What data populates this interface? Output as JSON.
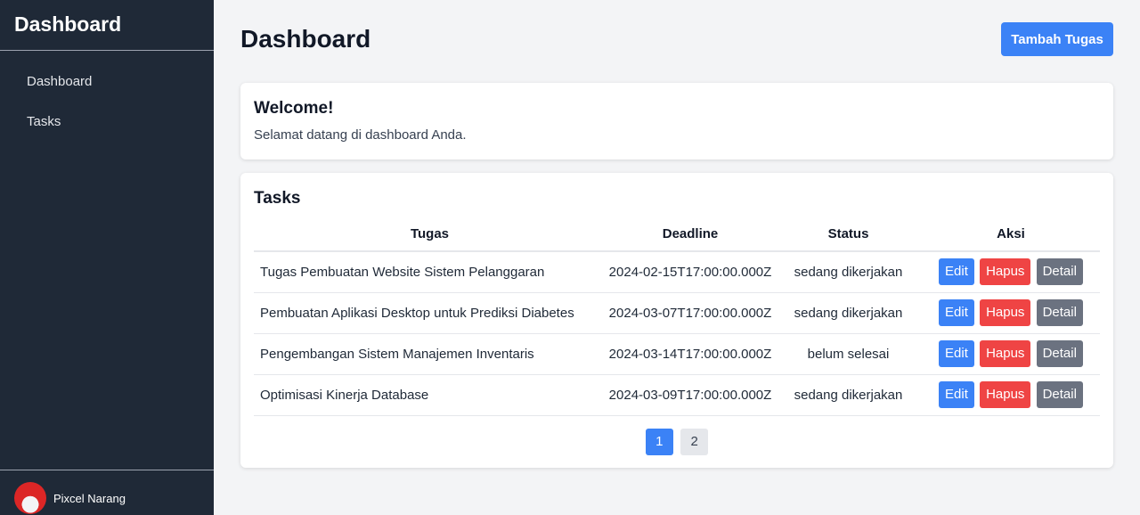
{
  "sidebar": {
    "title": "Dashboard",
    "items": [
      {
        "label": "Dashboard"
      },
      {
        "label": "Tasks"
      }
    ],
    "user": {
      "name": "Pixcel Narang"
    }
  },
  "header": {
    "title": "Dashboard",
    "add_button": "Tambah Tugas"
  },
  "welcome": {
    "title": "Welcome!",
    "text": "Selamat datang di dashboard Anda."
  },
  "tasks": {
    "title": "Tasks",
    "columns": [
      "Tugas",
      "Deadline",
      "Status",
      "Aksi"
    ],
    "rows": [
      {
        "task": "Tugas Pembuatan Website Sistem Pelanggaran",
        "deadline": "2024-02-15T17:00:00.000Z",
        "status": "sedang dikerjakan"
      },
      {
        "task": "Pembuatan Aplikasi Desktop untuk Prediksi Diabetes",
        "deadline": "2024-03-07T17:00:00.000Z",
        "status": "sedang dikerjakan"
      },
      {
        "task": "Pengembangan Sistem Manajemen Inventaris",
        "deadline": "2024-03-14T17:00:00.000Z",
        "status": "belum selesai"
      },
      {
        "task": "Optimisasi Kinerja Database",
        "deadline": "2024-03-09T17:00:00.000Z",
        "status": "sedang dikerjakan"
      }
    ],
    "actions": {
      "edit": "Edit",
      "delete": "Hapus",
      "detail": "Detail"
    },
    "pagination": {
      "pages": [
        "1",
        "2"
      ],
      "current": "1"
    }
  },
  "colors": {
    "sidebar_bg": "#1f2937",
    "primary": "#3b82f6",
    "danger": "#ef4444",
    "secondary": "#6b7280",
    "page_bg": "#f3f4f6"
  }
}
